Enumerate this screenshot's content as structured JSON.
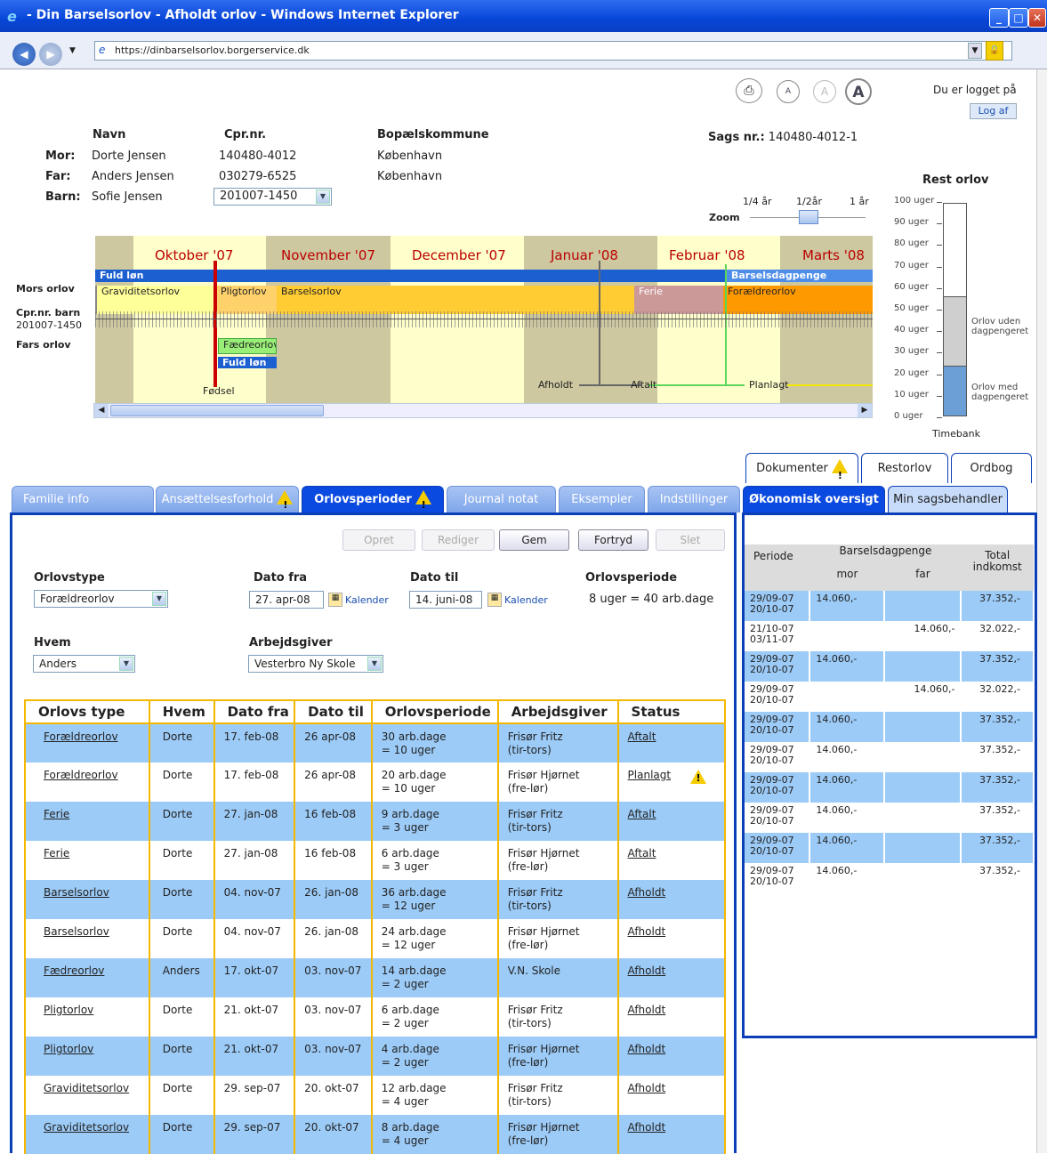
{
  "window": {
    "title": "- Din Barselsorlov - Afholdt orlov - Windows Internet Explorer",
    "url": "https://dinbarselsorlov.borgerservice.dk"
  },
  "header": {
    "font_small": "A",
    "font_mid": "A",
    "font_large": "A",
    "logged_in": "Du er logget på",
    "logout": "Log af",
    "sags_label": "Sags nr.:",
    "sags_nr": "140480-4012-1"
  },
  "family": {
    "col_name": "Navn",
    "col_cpr": "Cpr.nr.",
    "col_kommune": "Bopælskommune",
    "rows": [
      {
        "role": "Mor:",
        "name": "Dorte Jensen",
        "cpr": "140480-4012",
        "kommune": "København"
      },
      {
        "role": "Far:",
        "name": "Anders Jensen",
        "cpr": "030279-6525",
        "kommune": "København"
      },
      {
        "role": "Barn:",
        "name": "Sofie Jensen",
        "cpr": "201007-1450",
        "kommune": ""
      }
    ]
  },
  "zoom": {
    "label": "Zoom",
    "q": "1/4 år",
    "h": "1/2år",
    "y": "1 år"
  },
  "timeline": {
    "months": [
      "Oktober '07",
      "November '07",
      "December '07",
      "Januar '08",
      "Februar '08",
      "Marts '08"
    ],
    "row_mor": "Mors orlov",
    "row_cpr1": "Cpr.nr. barn",
    "row_cpr2": "201007-1450",
    "row_far": "Fars orlov",
    "fuld_lon": "Fuld løn",
    "barselsdagpenge": "Barselsdagpenge",
    "graviditet": "Graviditetsorlov",
    "pligt": "Pligtorlov",
    "barsel": "Barselsorlov",
    "ferie": "Ferie",
    "foraeldre": "Forældreorlov",
    "faedre": "Fædreorlov",
    "fuld_lon2": "Fuld løn",
    "fodsel": "Fødsel",
    "afholdt": "Afholdt",
    "aftalt": "Aftalt",
    "planlagt": "Planlagt"
  },
  "rest": {
    "title": "Rest orlov",
    "ticks": [
      "100 uger",
      "90 uger",
      "80 uger",
      "70 uger",
      "60 uger",
      "50 uger",
      "40 uger",
      "30 uger",
      "20 uger",
      "10 uger",
      "0 uger"
    ],
    "uden1": "Orlov uden",
    "uden2": "dagpengeret",
    "med1": "Orlov med",
    "med2": "dagpengeret",
    "timebank": "Timebank",
    "uden_weeks": 33,
    "med_weeks": 23
  },
  "top_tabs": [
    "Dokumenter",
    "Restorlov",
    "Ordbog"
  ],
  "tabs": [
    "Familie info",
    "Ansættelsesforhold",
    "Orlovsperioder",
    "Journal notat",
    "Eksempler",
    "Indstillinger"
  ],
  "right_tabs": [
    "Økonomisk oversigt",
    "Min sagsbehandler"
  ],
  "buttons": {
    "opret": "Opret",
    "rediger": "Rediger",
    "gem": "Gem",
    "fortryd": "Fortryd",
    "slet": "Slet"
  },
  "form": {
    "type_label": "Orlovstype",
    "type_value": "Forældreorlov",
    "fra_label": "Dato fra",
    "fra_value": "27. apr-08",
    "til_label": "Dato til",
    "til_value": "14. juni-08",
    "kalender": "Kalender",
    "periode_label": "Orlovsperiode",
    "periode_value": "8 uger = 40 arb.dage",
    "hvem_label": "Hvem",
    "hvem_value": "Anders",
    "arb_label": "Arbejdsgiver",
    "arb_value": "Vesterbro Ny Skole"
  },
  "grid": {
    "headers": [
      "Orlovs type",
      "Hvem",
      "Dato fra",
      "Dato til",
      "Orlovsperiode",
      "Arbejdsgiver",
      "Status"
    ],
    "rows": [
      [
        "Forældreorlov",
        "Dorte",
        "17. feb-08",
        "26 apr-08",
        "30 arb.dage",
        "= 10 uger",
        "Frisør Fritz",
        "(tir-tors)",
        "Aftalt"
      ],
      [
        "Forældreorlov",
        "Dorte",
        "17. feb-08",
        "26 apr-08",
        "20 arb.dage",
        "= 10 uger",
        "Frisør Hjørnet",
        "(fre-lør)",
        "Planlagt"
      ],
      [
        "Ferie",
        "Dorte",
        "27. jan-08",
        "16 feb-08",
        "9 arb.dage",
        "= 3 uger",
        "Frisør Fritz",
        "(tir-tors)",
        "Aftalt"
      ],
      [
        "Ferie",
        "Dorte",
        "27. jan-08",
        "16 feb-08",
        "6 arb.dage",
        "= 3 uger",
        "Frisør Hjørnet",
        "(fre-lør)",
        "Aftalt"
      ],
      [
        "Barselsorlov",
        "Dorte",
        "04. nov-07",
        "26. jan-08",
        "36 arb.dage",
        "= 12 uger",
        "Frisør Fritz",
        "(tir-tors)",
        "Afholdt"
      ],
      [
        "Barselsorlov",
        "Dorte",
        "04. nov-07",
        "26. jan-08",
        "24 arb.dage",
        "= 12 uger",
        "Frisør Hjørnet",
        "(fre-lør)",
        "Afholdt"
      ],
      [
        "Fædreorlov",
        "Anders",
        "17. okt-07",
        "03. nov-07",
        "14 arb.dage",
        "= 2 uger",
        "V.N. Skole",
        "",
        "Afholdt"
      ],
      [
        "Pligtorlov",
        "Dorte",
        "21. okt-07",
        "03. nov-07",
        "6 arb.dage",
        "= 2 uger",
        "Frisør Fritz",
        "(tir-tors)",
        "Afholdt"
      ],
      [
        "Pligtorlov",
        "Dorte",
        "21. okt-07",
        "03. nov-07",
        "4 arb.dage",
        "= 2 uger",
        "Frisør Hjørnet",
        "(fre-lør)",
        "Afholdt"
      ],
      [
        "Graviditetsorlov",
        "Dorte",
        "29. sep-07",
        "20. okt-07",
        "12 arb.dage",
        "= 4 uger",
        "Frisør Fritz",
        "(tir-tors)",
        "Afholdt"
      ],
      [
        "Graviditetsorlov",
        "Dorte",
        "29. sep-07",
        "20. okt-07",
        "8 arb.dage",
        "= 4 uger",
        "Frisør Hjørnet",
        "(fre-lør)",
        "Afholdt"
      ]
    ]
  },
  "econ": {
    "h_periode": "Periode",
    "h_barsel": "Barselsdagpenge",
    "h_mor": "mor",
    "h_far": "far",
    "h_total1": "Total",
    "h_total2": "indkomst",
    "rows": [
      [
        "29/09-07",
        "20/10-07",
        "14.060,-",
        "",
        "37.352,-"
      ],
      [
        "21/10-07",
        "03/11-07",
        "",
        "14.060,-",
        "32.022,-"
      ],
      [
        "29/09-07",
        "20/10-07",
        "14.060,-",
        "",
        "37.352,-"
      ],
      [
        "29/09-07",
        "20/10-07",
        "",
        "14.060,-",
        "32.022,-"
      ],
      [
        "29/09-07",
        "20/10-07",
        "14.060,-",
        "",
        "37.352,-"
      ],
      [
        "29/09-07",
        "20/10-07",
        "14.060,-",
        "",
        "37.352,-"
      ],
      [
        "29/09-07",
        "20/10-07",
        "14.060,-",
        "",
        "37.352,-"
      ],
      [
        "29/09-07",
        "20/10-07",
        "14.060,-",
        "",
        "37.352,-"
      ],
      [
        "29/09-07",
        "20/10-07",
        "14.060,-",
        "",
        "37.352,-"
      ],
      [
        "29/09-07",
        "20/10-07",
        "14.060,-",
        "",
        "37.352,-"
      ]
    ]
  }
}
